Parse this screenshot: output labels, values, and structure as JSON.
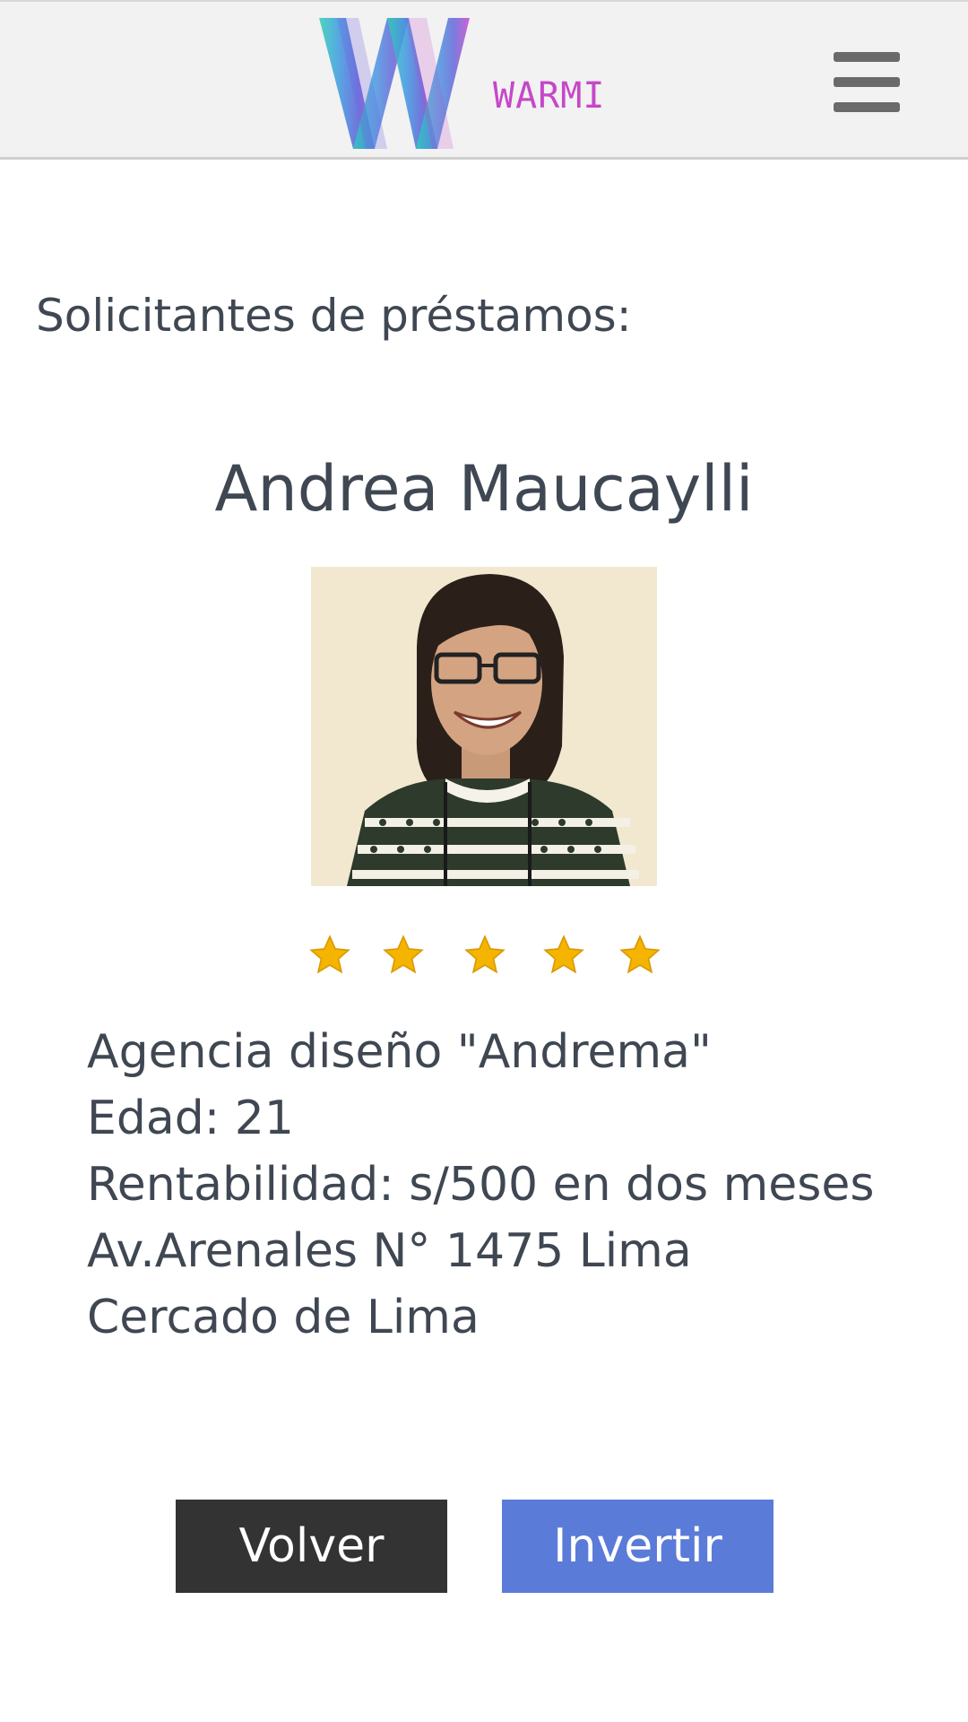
{
  "header": {
    "logo_text": "WARMI",
    "menu_icon": "hamburger-menu-icon"
  },
  "page": {
    "section_title": "Solicitantes de préstamos:"
  },
  "applicant": {
    "name": "Andrea Maucaylli",
    "photo_alt": "Andrea Maucaylli",
    "rating": 5,
    "rating_max": 5,
    "star_color": "#f5b400",
    "details": {
      "business": "Agencia diseño \"Andrema\"",
      "age": "Edad: 21",
      "profitability": "Rentabilidad: s/500 en dos meses",
      "address": "Av.Arenales N° 1475 Lima",
      "district": "Cercado de Lima"
    }
  },
  "actions": {
    "back_label": "Volver",
    "invest_label": "Invertir"
  },
  "colors": {
    "header_bg": "#f2f2f2",
    "back_button": "#333333",
    "invest_button": "#5b7bd8",
    "logo_text": "#c548c8"
  }
}
